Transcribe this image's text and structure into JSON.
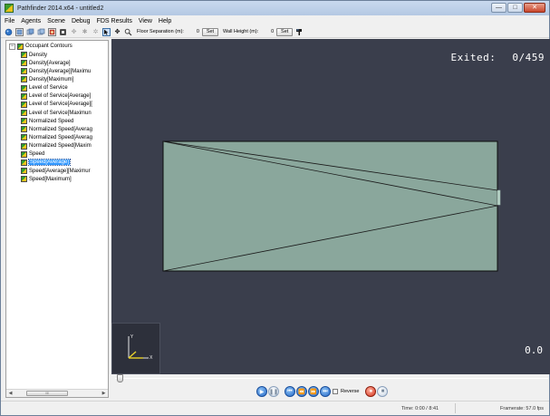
{
  "window": {
    "title": "Pathfinder 2014.x64 - untitled2",
    "controls": {
      "minimize": "—",
      "maximize": "□",
      "close": "✕"
    }
  },
  "menu": [
    "File",
    "Agents",
    "Scene",
    "Debug",
    "FDS Results",
    "View",
    "Help"
  ],
  "toolbar": {
    "icons": [
      "orbit-icon",
      "view-front-icon",
      "view-side-icon",
      "view-top-icon",
      "render-mode-icon",
      "filled-mode-icon",
      "move-tool-icon",
      "rotate-tool-icon",
      "fly-tool-icon",
      "select-tool-icon",
      "pan-tool-icon",
      "zoom-tool-icon"
    ],
    "floor_separation_label": "Floor Separation (m):",
    "floor_separation_value": "0",
    "floor_set": "Set",
    "wall_height_label": "Wall Height (m):",
    "wall_height_value": "0",
    "wall_set": "Set"
  },
  "tree": {
    "root_label": "Occupant Contours",
    "items": [
      {
        "label": "Density"
      },
      {
        "label": "Density[Average]"
      },
      {
        "label": "Density[Average][Maximu"
      },
      {
        "label": "Density[Maximum]"
      },
      {
        "label": "Level of Service"
      },
      {
        "label": "Level of Service[Average]"
      },
      {
        "label": "Level of Service[Average]["
      },
      {
        "label": "Level of Service[Maximun"
      },
      {
        "label": "Normalized Speed"
      },
      {
        "label": "Normalized Speed[Averag"
      },
      {
        "label": "Normalized Speed[Averag"
      },
      {
        "label": "Normalized Speed[Maxim"
      },
      {
        "label": "Speed"
      },
      {
        "label": "Speed[Average]",
        "selected": true
      },
      {
        "label": "Speed[Average][Maximur"
      },
      {
        "label": "Speed[Maximum]"
      }
    ],
    "scroll_thumb": "III"
  },
  "viewport": {
    "exited_label": "Exited:",
    "exited_value": "0/459",
    "time_display": "0.0",
    "floor_color": "#8aa79c",
    "background_color": "#3a3e4c"
  },
  "playback": {
    "reverse_label": "Reverse"
  },
  "status": {
    "time": "Time: 0:00 / 8:41",
    "framerate": "Framerate: 57.0 fps"
  }
}
